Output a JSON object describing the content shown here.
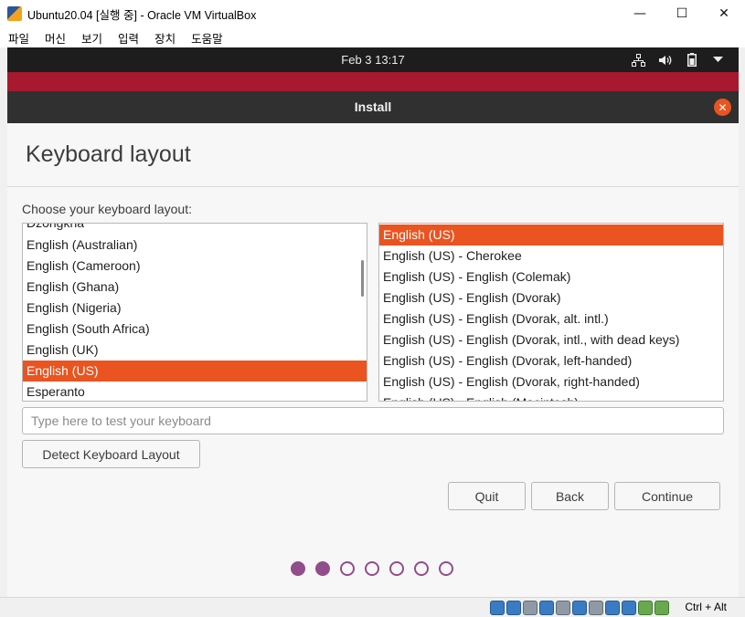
{
  "window": {
    "title": "Ubuntu20.04 [실행 중] - Oracle VM VirtualBox",
    "controls": {
      "minimize": "—",
      "maximize": "☐",
      "close": "✕"
    }
  },
  "menu": [
    "파일",
    "머신",
    "보기",
    "입력",
    "장치",
    "도움말"
  ],
  "gnome": {
    "clock": "Feb 3  13:17",
    "tray_icons": [
      "network-icon",
      "volume-icon",
      "battery-icon",
      "dropdown-arrow-icon"
    ]
  },
  "installer": {
    "title": "Install",
    "page_title": "Keyboard layout",
    "choose_label": "Choose your keyboard layout:",
    "layouts": [
      "Dzongkha",
      "English (Australian)",
      "English (Cameroon)",
      "English (Ghana)",
      "English (Nigeria)",
      "English (South Africa)",
      "English (UK)",
      "English (US)",
      "Esperanto"
    ],
    "selected_layout": "English (US)",
    "variants": [
      "English (US)",
      "English (US) - Cherokee",
      "English (US) - English (Colemak)",
      "English (US) - English (Dvorak)",
      "English (US) - English (Dvorak, alt. intl.)",
      "English (US) - English (Dvorak, intl., with dead keys)",
      "English (US) - English (Dvorak, left-handed)",
      "English (US) - English (Dvorak, right-handed)",
      "English (US) - English (Macintosh)"
    ],
    "selected_variant": "English (US)",
    "test_placeholder": "Type here to test your keyboard",
    "detect_button": "Detect Keyboard Layout",
    "quit_button": "Quit",
    "back_button": "Back",
    "continue_button": "Continue",
    "progress": {
      "total_steps": 7,
      "completed_steps": 2
    }
  },
  "status_bar": {
    "host_key": "Ctrl + Alt"
  },
  "colors": {
    "accent": "#e95420",
    "progress_dot": "#924d8b",
    "top_bar": "#1d1d1d",
    "band": "#a6192e"
  }
}
